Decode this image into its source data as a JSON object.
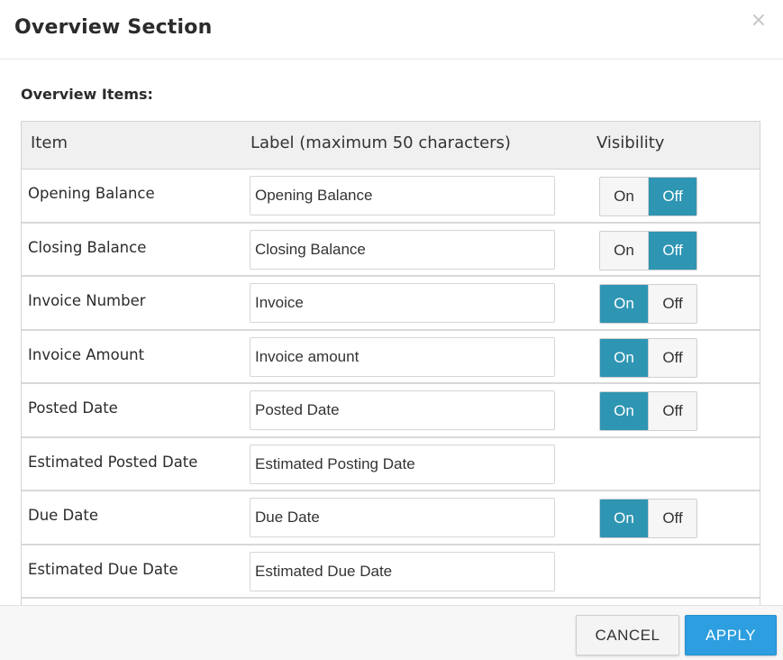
{
  "modal": {
    "title": "Overview Section",
    "close_icon": "×"
  },
  "section_label": "Overview Items:",
  "table": {
    "headers": {
      "item": "Item",
      "label": "Label (maximum 50 characters)",
      "visibility": "Visibility"
    },
    "rows": [
      {
        "item": "Opening Balance",
        "label": "Opening Balance",
        "has_toggle": true,
        "visible": false
      },
      {
        "item": "Closing Balance",
        "label": "Closing Balance",
        "has_toggle": true,
        "visible": false
      },
      {
        "item": "Invoice Number",
        "label": "Invoice",
        "has_toggle": true,
        "visible": true
      },
      {
        "item": "Invoice Amount",
        "label": "Invoice amount",
        "has_toggle": true,
        "visible": true
      },
      {
        "item": "Posted Date",
        "label": "Posted Date",
        "has_toggle": true,
        "visible": true
      },
      {
        "item": "Estimated Posted Date",
        "label": "Estimated Posting Date",
        "has_toggle": false
      },
      {
        "item": "Due Date",
        "label": "Due Date",
        "has_toggle": true,
        "visible": true
      },
      {
        "item": "Estimated Due Date",
        "label": "Estimated Due Date",
        "has_toggle": false
      },
      {
        "item": "",
        "label": "",
        "has_toggle": false
      }
    ]
  },
  "toggle": {
    "on_label": "On",
    "off_label": "Off"
  },
  "footer": {
    "cancel_label": "CANCEL",
    "apply_label": "APPLY"
  },
  "colors": {
    "toggle_active": "#2e95b3",
    "apply_button": "#2d9ee0",
    "header_background": "#f0f0f0"
  }
}
